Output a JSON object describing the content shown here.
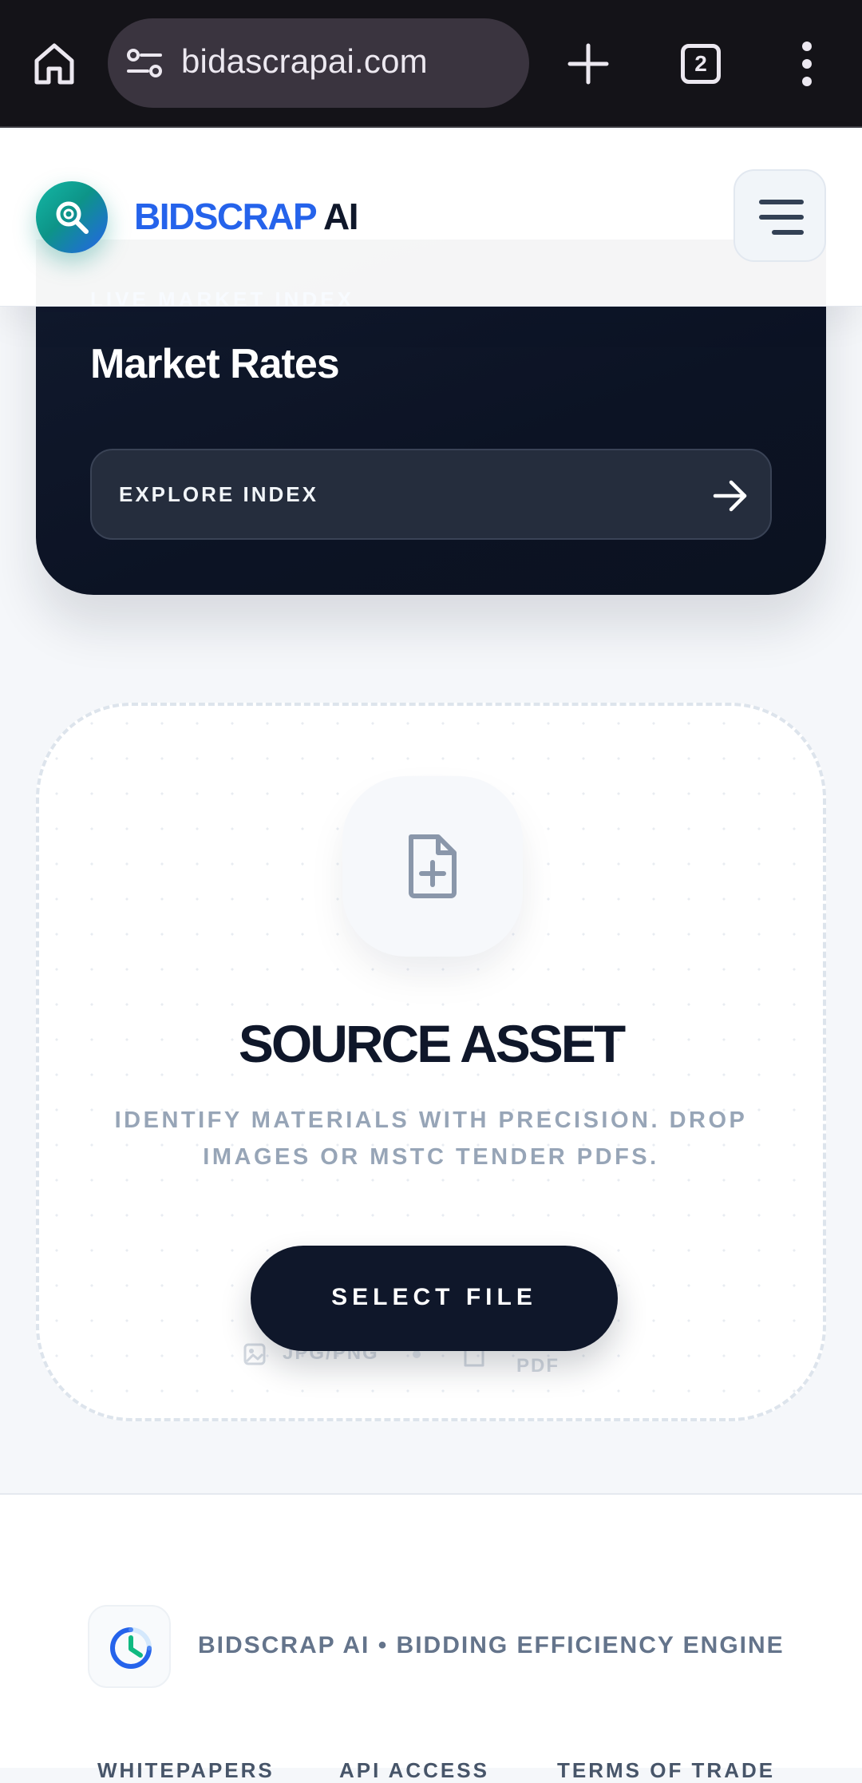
{
  "browser": {
    "url": "bidascrapai.com",
    "tab_count": "2",
    "icons": [
      "home-icon",
      "site-settings-icon",
      "new-tab-icon",
      "tab-switcher-icon",
      "overflow-menu-icon"
    ]
  },
  "header": {
    "brand_primary": "BIDSCRAP",
    "brand_secondary": "AI",
    "brand_color": "#2563eb",
    "logo_icon": "magnifier-icon",
    "menu_icon": "hamburger-icon"
  },
  "market": {
    "eyebrow": "LIVE MARKET INDEX",
    "title": "Market Rates",
    "button_label": "EXPLORE INDEX",
    "button_icon": "arrow-right-icon"
  },
  "upload": {
    "icon": "file-plus-icon",
    "title": "SOURCE ASSET",
    "description": "IDENTIFY MATERIALS WITH PRECISION. DROP IMAGES OR MSTC TENDER PDFS.",
    "button_label": "SELECT FILE",
    "formats": [
      "JPG/PNG",
      "PDF"
    ]
  },
  "footer": {
    "icon": "clock-icon",
    "tagline": "BIDSCRAP AI • BIDDING EFFICIENCY ENGINE",
    "links": [
      "WHITEPAPERS",
      "API ACCESS",
      "TERMS OF TRADE"
    ]
  }
}
